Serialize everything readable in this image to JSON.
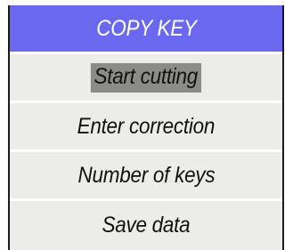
{
  "menu": {
    "title": "COPY KEY",
    "selected_index": 0,
    "items": [
      {
        "label": "Start cutting"
      },
      {
        "label": "Enter correction"
      },
      {
        "label": "Number of keys"
      },
      {
        "label": "Save data"
      }
    ]
  },
  "colors": {
    "header_background": "#6b68f0",
    "menu_background": "#ececea",
    "selection_highlight": "#8b8c88",
    "border": "#1a1a1a"
  }
}
